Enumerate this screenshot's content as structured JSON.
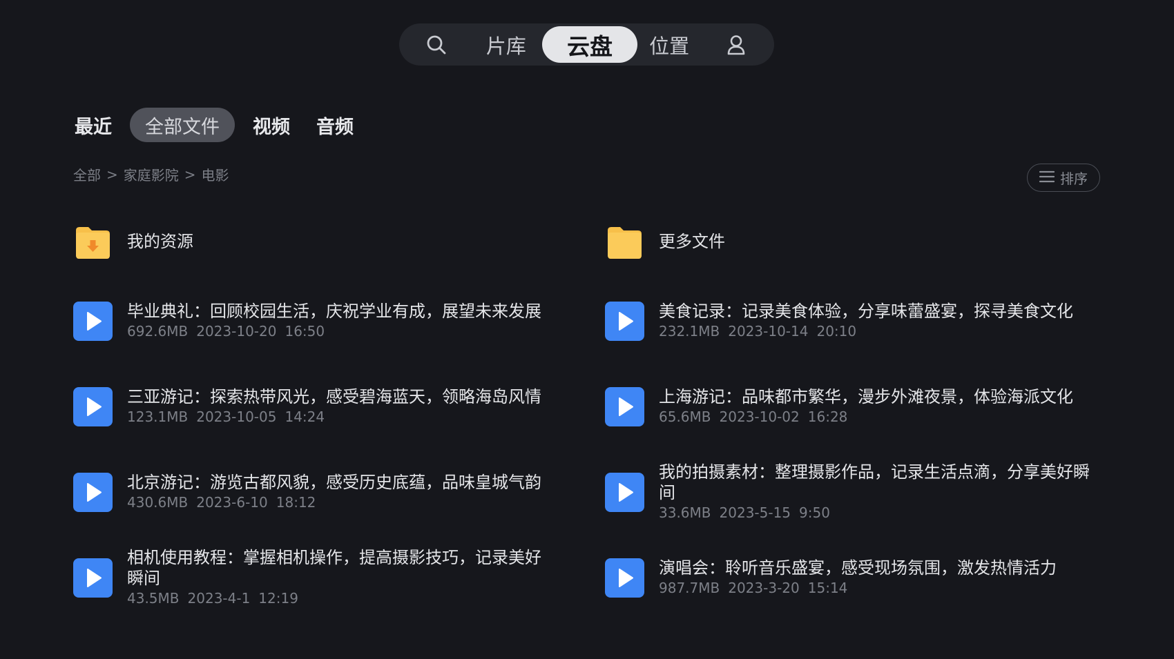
{
  "topnav": {
    "items": [
      {
        "icon": "search-icon"
      },
      {
        "label": "片库"
      },
      {
        "label": "云盘"
      },
      {
        "label": "位置"
      },
      {
        "icon": "profile-icon"
      }
    ],
    "active": "云盘"
  },
  "subtabs": [
    {
      "label": "最近"
    },
    {
      "label": "全部文件"
    },
    {
      "label": "视频"
    },
    {
      "label": "音频"
    }
  ],
  "breadcrumb": {
    "items": [
      "全部",
      "家庭影院",
      "电影"
    ],
    "separator": ">"
  },
  "sort": {
    "label": "排序",
    "icon": "list-icon"
  },
  "folders": [
    {
      "name": "我的资源",
      "icon": "download-folder-icon"
    },
    {
      "name": "更多文件",
      "icon": "folder-icon"
    }
  ],
  "files": [
    {
      "name": "毕业典礼：回顾校园生活，庆祝学业有成，展望未来发展",
      "size": "692.6MB",
      "date": "2023-10-20",
      "time": "16:50"
    },
    {
      "name": "美食记录：记录美食体验，分享味蕾盛宴，探寻美食文化",
      "size": "232.1MB",
      "date": "2023-10-14",
      "time": "20:10"
    },
    {
      "name": "三亚游记：探索热带风光，感受碧海蓝天，领略海岛风情",
      "size": "123.1MB",
      "date": "2023-10-05",
      "time": "14:24"
    },
    {
      "name": "上海游记：品味都市繁华，漫步外滩夜景，体验海派文化",
      "size": "65.6MB",
      "date": "2023-10-02",
      "time": "16:28"
    },
    {
      "name": "北京游记：游览古都风貌，感受历史底蕴，品味皇城气韵",
      "size": "430.6MB",
      "date": "2023-6-10",
      "time": "18:12"
    },
    {
      "name": "我的拍摄素材：整理摄影作品，记录生活点滴，分享美好瞬间",
      "size": "33.6MB",
      "date": "2023-5-15",
      "time": "9:50"
    },
    {
      "name": "相机使用教程：掌握相机操作，提高摄影技巧，记录美好瞬间",
      "size": "43.5MB",
      "date": "2023-4-1",
      "time": "12:19"
    },
    {
      "name": "演唱会：聆听音乐盛宴，感受现场氛围，激发热情活力",
      "size": "987.7MB",
      "date": "2023-3-20",
      "time": "15:14"
    }
  ],
  "colors": {
    "background": "#16171c",
    "folder": "#f7c04a",
    "video": "#3f86f5"
  }
}
